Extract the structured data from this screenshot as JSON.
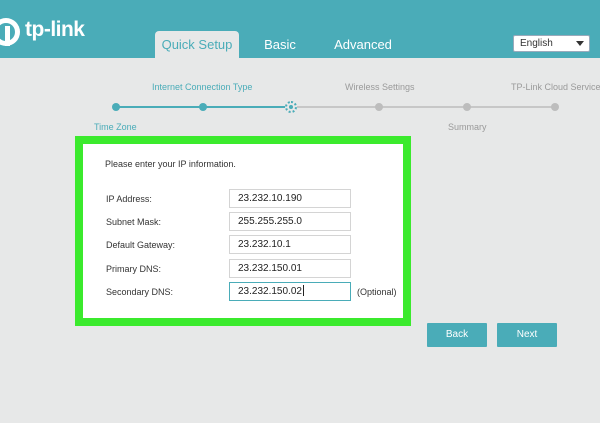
{
  "brand": {
    "logo_text": "tp-link",
    "accent_color": "#4aacb8",
    "highlight_color": "#3bea2d"
  },
  "nav": {
    "tabs": [
      {
        "label": "Quick Setup",
        "active": true
      },
      {
        "label": "Basic",
        "active": false
      },
      {
        "label": "Advanced",
        "active": false
      }
    ],
    "language": {
      "selected": "English"
    }
  },
  "stepper": {
    "steps": [
      {
        "label": "Time Zone",
        "state": "done"
      },
      {
        "label": "Internet Connection Type",
        "state": "done"
      },
      {
        "label": "",
        "state": "current"
      },
      {
        "label": "Wireless Settings",
        "state": "todo"
      },
      {
        "label": "Summary",
        "state": "todo"
      },
      {
        "label": "TP-Link Cloud Service",
        "state": "todo"
      }
    ]
  },
  "form": {
    "title": "Please enter your IP information.",
    "fields": [
      {
        "label": "IP Address:",
        "value": "23.232.10.190"
      },
      {
        "label": "Subnet Mask:",
        "value": "255.255.255.0"
      },
      {
        "label": "Default Gateway:",
        "value": "23.232.10.1"
      },
      {
        "label": "Primary DNS:",
        "value": "23.232.150.01"
      },
      {
        "label": "Secondary DNS:",
        "value": "23.232.150.02",
        "note": "(Optional)"
      }
    ]
  },
  "actions": {
    "back_label": "Back",
    "next_label": "Next"
  }
}
